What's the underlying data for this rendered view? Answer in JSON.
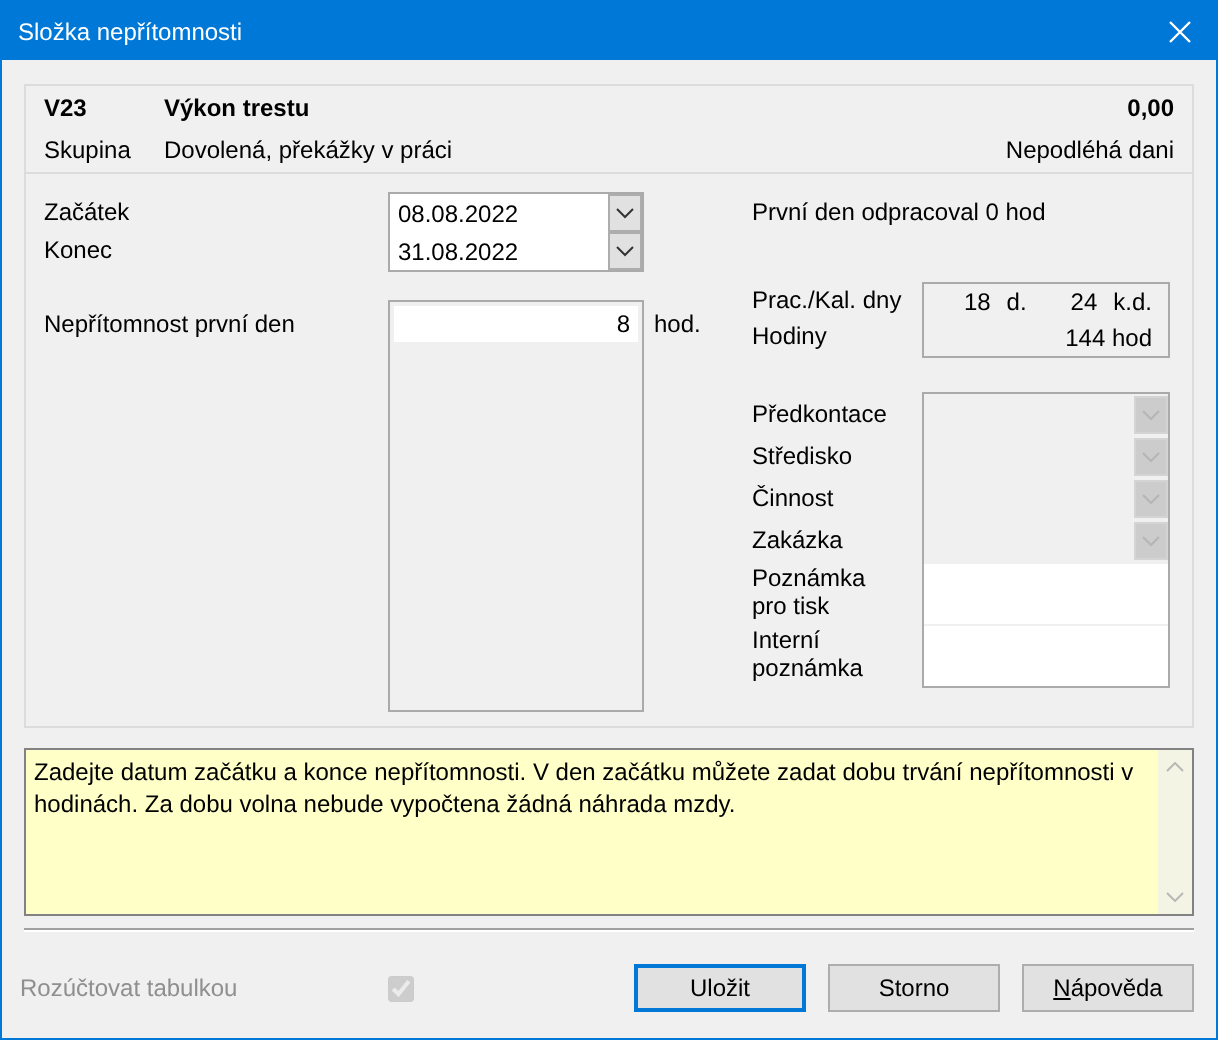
{
  "window": {
    "title": "Složka nepřítomnosti"
  },
  "header": {
    "code": "V23",
    "name": "Výkon trestu",
    "amount": "0,00",
    "group_label": "Skupina",
    "group": "Dovolená, překážky v práci",
    "tax": "Nepodléhá dani"
  },
  "dates": [
    {
      "label": "Začátek",
      "value": "08.08.2022"
    },
    {
      "label": "Konec",
      "value": "31.08.2022"
    }
  ],
  "note": "První den odpracoval 0 hod",
  "first_day": {
    "label": "Nepřítomnost první den",
    "value": "8",
    "unit": "hod."
  },
  "summary": {
    "days_label": "Prac./Kal. dny",
    "work_days": "18",
    "work_unit": "d.",
    "cal_days": "24",
    "cal_unit": "k.d.",
    "hours_label": "Hodiny",
    "hours": "144 hod"
  },
  "fields": [
    {
      "kind": "combo",
      "label": "Předkontace",
      "disabled": true
    },
    {
      "kind": "combo",
      "label": "Středisko",
      "disabled": true
    },
    {
      "kind": "combo",
      "label": "Činnost",
      "disabled": true
    },
    {
      "kind": "combo",
      "label": "Zakázka",
      "disabled": true
    },
    {
      "kind": "text",
      "label": "Poznámka pro tisk",
      "disabled": false
    },
    {
      "kind": "text",
      "label": "Interní poznámka",
      "disabled": false
    }
  ],
  "help_text": "Zadejte datum začátku a konce nepřítomnosti. V den začátku můžete zadat dobu trvání nepřítomnosti v hodinách. Za dobu volna nebude vypočtena žádná náhrada mzdy.",
  "split_option": {
    "label": "Rozúčtovat tabulkou",
    "checked": true,
    "disabled": true
  },
  "buttons": [
    {
      "label": "Uložit",
      "default": true,
      "mnemonic": false
    },
    {
      "label": "Storno",
      "default": false,
      "mnemonic": false
    },
    {
      "label": "Nápověda",
      "default": false,
      "mnemonic": true
    }
  ]
}
